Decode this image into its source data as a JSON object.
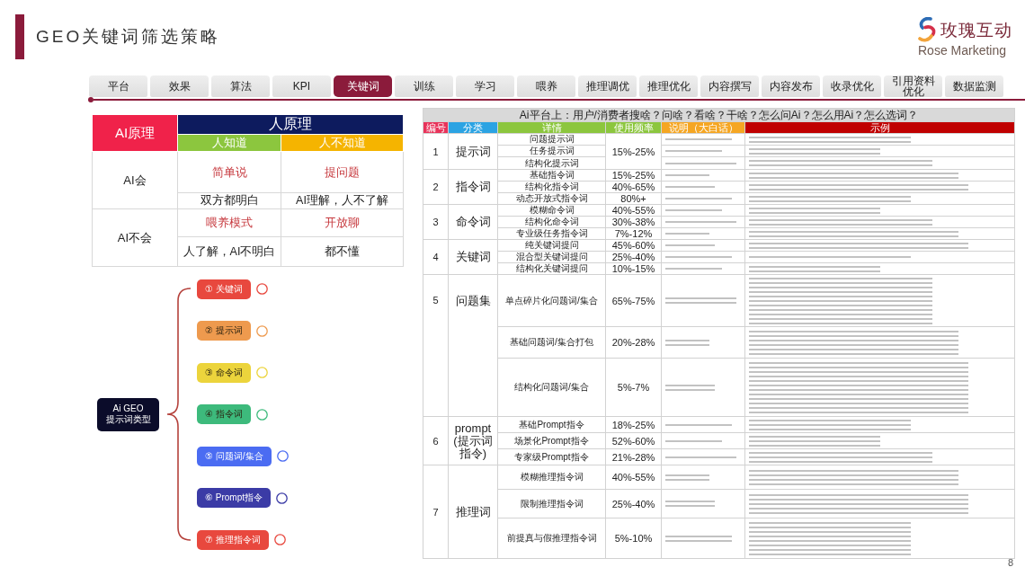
{
  "slide": {
    "title": "GEO关键词筛选策略",
    "page_number": "8"
  },
  "logo": {
    "name": "玫瑰互动",
    "tagline": "Rose Marketing"
  },
  "tabs": [
    {
      "label": "平台",
      "selected": false
    },
    {
      "label": "效果",
      "selected": false
    },
    {
      "label": "算法",
      "selected": false
    },
    {
      "label": "KPI",
      "selected": false
    },
    {
      "label": "关键词",
      "selected": true
    },
    {
      "label": "训练",
      "selected": false
    },
    {
      "label": "学习",
      "selected": false
    },
    {
      "label": "喂养",
      "selected": false
    },
    {
      "label": "推理调优",
      "selected": false
    },
    {
      "label": "推理优化",
      "selected": false
    },
    {
      "label": "内容撰写",
      "selected": false
    },
    {
      "label": "内容发布",
      "selected": false
    },
    {
      "label": "收录优化",
      "selected": false
    },
    {
      "label": "引用资料优化",
      "selected": false
    },
    {
      "label": "数据监测",
      "selected": false
    }
  ],
  "principle_table": {
    "corner": "AI原理",
    "group_header": "人原理",
    "columns": [
      {
        "label": "人知道",
        "color": "#8cc63e"
      },
      {
        "label": "人不知道",
        "color": "#f5b400"
      }
    ],
    "rows": [
      {
        "label": "AI会",
        "keywords": [
          "简单说",
          "提问题"
        ],
        "notes": [
          "双方都明白",
          "AI理解，人不了解"
        ]
      },
      {
        "label": "AI不会",
        "keywords": [
          "喂养模式",
          "开放聊"
        ],
        "notes": [
          "人了解，AI不明白",
          "都不懂"
        ]
      }
    ]
  },
  "mind_map": {
    "center": [
      "Ai GEO",
      "提示词类型"
    ],
    "branches": [
      {
        "label": "① 关键词",
        "color": "#e8483e"
      },
      {
        "label": "② 提示词",
        "color": "#ee9a4e"
      },
      {
        "label": "③ 命令词",
        "color": "#ecd43c"
      },
      {
        "label": "④ 指令词",
        "color": "#3dba7c"
      },
      {
        "label": "⑤ 问题词/集合",
        "color": "#4b6cf2"
      },
      {
        "label": "⑥ Prompt指令",
        "color": "#3b3ba6"
      },
      {
        "label": "⑦ 推理指令词",
        "color": "#e8483e"
      }
    ]
  },
  "keyword_table": {
    "title": "Ai平台上：用户/消费者搜啥？问啥？看啥？干啥？怎么问Ai？怎么用Ai？怎么选词？",
    "columns": [
      {
        "label": "编号",
        "color": "#e8335a"
      },
      {
        "label": "分类",
        "color": "#2ba3e3"
      },
      {
        "label": "详情",
        "color": "#8cc63e"
      },
      {
        "label": "使用频率",
        "color": "#8cc63e"
      },
      {
        "label": "说明（大白话）",
        "color": "#f5a623"
      },
      {
        "label": "示例",
        "color": "#c00000"
      }
    ],
    "groups": [
      {
        "number": "1",
        "category": "提示词",
        "frequency": "15%-25%",
        "items": [
          {
            "detail": "问题提示词"
          },
          {
            "detail": "任务提示词"
          },
          {
            "detail": "结构化提示词"
          }
        ]
      },
      {
        "number": "2",
        "category": "指令词",
        "items": [
          {
            "detail": "基础指令词",
            "frequency": "15%-25%"
          },
          {
            "detail": "结构化指令词",
            "frequency": "40%-65%"
          },
          {
            "detail": "动态开放式指令词",
            "frequency": "80%+"
          }
        ]
      },
      {
        "number": "3",
        "category": "命令词",
        "items": [
          {
            "detail": "模糊命令词",
            "frequency": "40%-55%"
          },
          {
            "detail": "结构化命令词",
            "frequency": "30%-38%"
          },
          {
            "detail": "专业级任务指令词",
            "frequency": "7%-12%"
          }
        ]
      },
      {
        "number": "4",
        "category": "关键词",
        "items": [
          {
            "detail": "纯关键词提问",
            "frequency": "45%-60%"
          },
          {
            "detail": "混合型关键词提问",
            "frequency": "25%-40%"
          },
          {
            "detail": "结构化关键词提问",
            "frequency": "10%-15%"
          }
        ]
      },
      {
        "number": "5",
        "category": "问题集",
        "items": [
          {
            "detail": "单点碎片化问题词/集合",
            "frequency": "65%-75%"
          },
          {
            "detail": "基础问题词/集合打包",
            "frequency": "20%-28%"
          },
          {
            "detail": "结构化问题词/集合",
            "frequency": "5%-7%"
          }
        ]
      },
      {
        "number": "6",
        "category": "prompt (提示词指令)",
        "items": [
          {
            "detail": "基础Prompt指令",
            "frequency": "18%-25%"
          },
          {
            "detail": "场景化Prompt指令",
            "frequency": "52%-60%"
          },
          {
            "detail": "专家级Prompt指令",
            "frequency": "21%-28%"
          }
        ]
      },
      {
        "number": "7",
        "category": "推理词",
        "items": [
          {
            "detail": "模糊推理指令词",
            "frequency": "40%-55%"
          },
          {
            "detail": "限制推理指令词",
            "frequency": "25%-40%"
          },
          {
            "detail": "前提真与假推理指令词",
            "frequency": "5%-10%"
          }
        ]
      }
    ]
  }
}
